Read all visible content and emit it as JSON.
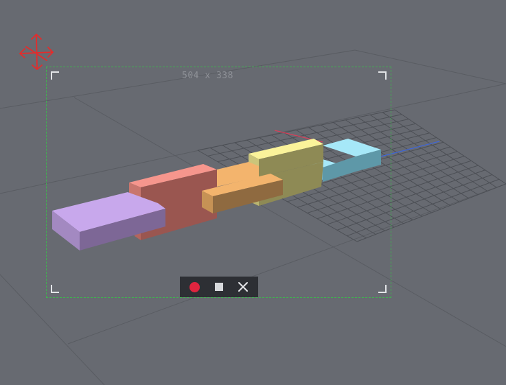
{
  "capture": {
    "dimensions_label": "504 x 338"
  },
  "toolbar": {
    "buttons": [
      {
        "name": "record",
        "icon": "record-icon",
        "color": "#e0253f"
      },
      {
        "name": "stop",
        "icon": "stop-icon"
      },
      {
        "name": "close",
        "icon": "close-icon"
      }
    ]
  },
  "move_handle": {
    "icon": "move-arrows-icon",
    "color": "#e52b2b"
  },
  "scene": {
    "background_color": "#676a71",
    "grid_color": "#4c4f55",
    "axis_colors": {
      "x": "#d8405a",
      "z": "#3f66d8"
    },
    "blocks": [
      {
        "name": "purple-block",
        "color": "#c4a6ea"
      },
      {
        "name": "red-block",
        "color": "#f2948c"
      },
      {
        "name": "orange-block",
        "color": "#f0b26c"
      },
      {
        "name": "yellow-block",
        "color": "#f7ef93"
      },
      {
        "name": "cyan-block",
        "color": "#9fe3f6"
      }
    ]
  },
  "frame": {
    "border_color": "#3fb34f"
  }
}
